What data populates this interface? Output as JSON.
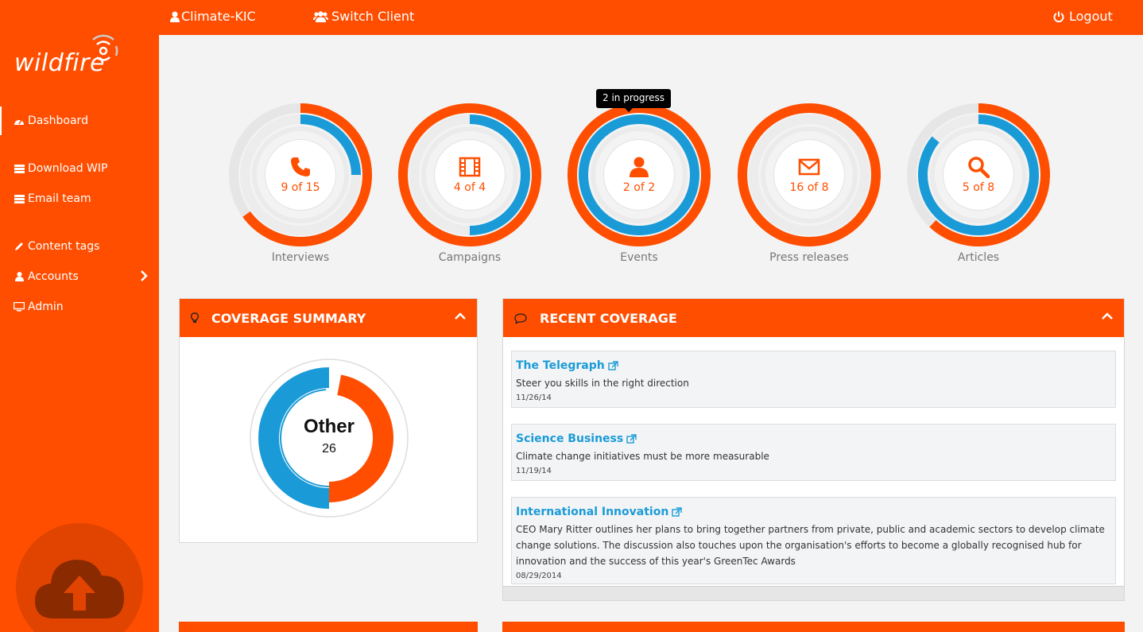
{
  "brand": {
    "logo_text": "wildfire"
  },
  "topbar": {
    "client_label": "Climate-KIC",
    "switch_label": "Switch Client",
    "logout_label": "Logout"
  },
  "sidebar": {
    "items": [
      {
        "label": "Dashboard",
        "icon": "dashboard-icon"
      },
      {
        "label": "Download WIP",
        "icon": "list-icon"
      },
      {
        "label": "Email team",
        "icon": "list-icon"
      },
      {
        "label": "Content tags",
        "icon": "pencil-icon"
      },
      {
        "label": "Accounts",
        "icon": "user-icon"
      },
      {
        "label": "Admin",
        "icon": "monitor-icon"
      }
    ]
  },
  "stats": [
    {
      "label": "Interviews",
      "count": "9 of 15",
      "icon": "phone-icon",
      "outer_fraction": 0.65,
      "inner_fraction": 0.25
    },
    {
      "label": "Campaigns",
      "count": "4 of 4",
      "icon": "film-icon",
      "outer_fraction": 1.0,
      "inner_fraction": 0.5
    },
    {
      "label": "Events",
      "count": "2 of 2",
      "icon": "user-icon",
      "outer_fraction": 1.0,
      "inner_fraction": 1.0
    },
    {
      "label": "Press releases",
      "count": "16 of 8",
      "icon": "envelope-icon",
      "outer_fraction": 1.0,
      "inner_fraction": 0.0
    },
    {
      "label": "Articles",
      "count": "5 of 8",
      "icon": "search-icon",
      "outer_fraction": 0.62,
      "inner_fraction": 0.86
    }
  ],
  "tooltip": "2 in progress",
  "coverage_summary": {
    "title": "COVERAGE SUMMARY",
    "center_label": "Other",
    "center_value": "26",
    "colors": {
      "blue": "#1a9bd7",
      "orange": "#ff4e00"
    },
    "blue_fraction": 0.56
  },
  "recent_coverage": {
    "title": "RECENT COVERAGE",
    "items": [
      {
        "title": "The Telegraph",
        "desc": "Steer you skills in the right direction",
        "date": "11/26/14"
      },
      {
        "title": "Science Business",
        "desc": "Climate change initiatives must be more measurable",
        "date": "11/19/14"
      },
      {
        "title": "International Innovation",
        "desc": "CEO Mary Ritter outlines her plans to bring together partners from private, public and academic sectors to develop climate change solutions. The discussion also touches upon the organisation's efforts to become a globally recognised hub for innovation and the success of this year's GreenTec Awards",
        "date": "08/29/2014"
      }
    ]
  },
  "colors": {
    "accent": "#ff4e00",
    "blue": "#1a9bd7",
    "track": "#e6e6e6"
  }
}
